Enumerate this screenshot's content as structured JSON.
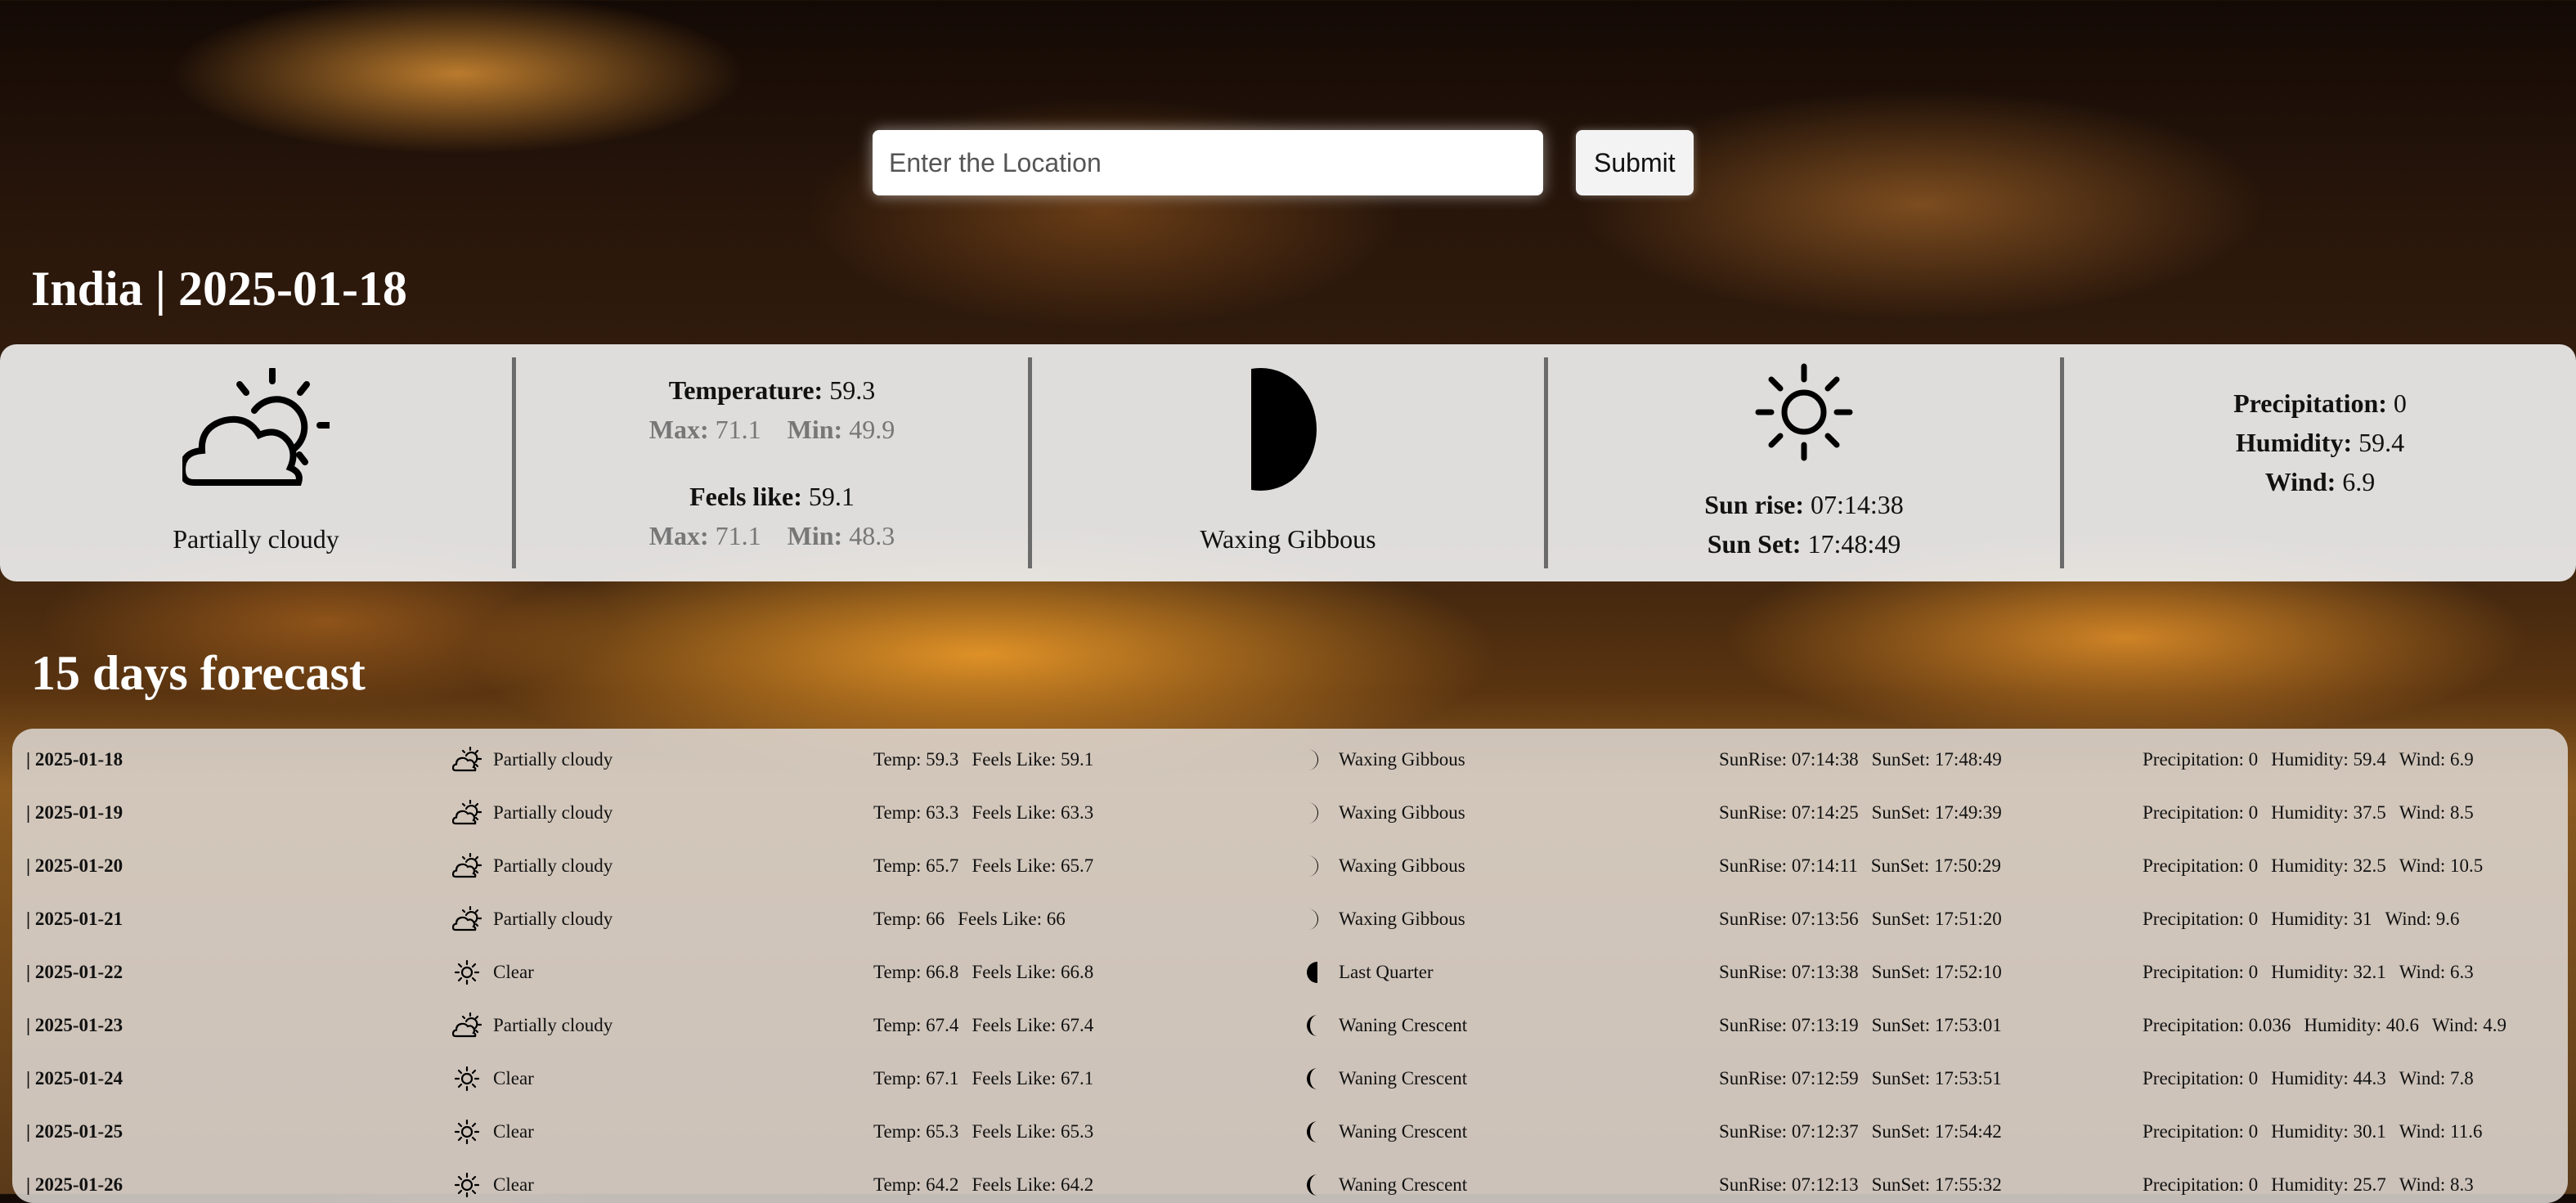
{
  "search": {
    "placeholder": "Enter the Location",
    "value": "",
    "submit_label": "Submit"
  },
  "header": {
    "title": "India | 2025-01-18"
  },
  "current": {
    "condition": "Partially cloudy",
    "condition_icon": "partly-cloudy-day-icon",
    "temperature_label": "Temperature:",
    "temperature": "59.3",
    "max_label": "Max:",
    "temp_max": "71.1",
    "min_label": "Min:",
    "temp_min": "49.9",
    "feels_label": "Feels like:",
    "feels_like": "59.1",
    "feels_max": "71.1",
    "feels_min": "48.3",
    "moon_phase": "Waxing Gibbous",
    "moon_icon": "moon-waxing-gibbous-icon",
    "sun_icon": "sun-icon",
    "sunrise_label": "Sun rise:",
    "sunrise": "07:14:38",
    "sunset_label": "Sun Set:",
    "sunset": "17:48:49",
    "precipitation_label": "Precipitation:",
    "precipitation": "0",
    "humidity_label": "Humidity:",
    "humidity": "59.4",
    "wind_label": "Wind:",
    "wind": "6.9"
  },
  "forecast": {
    "title": "15 days forecast",
    "rows": [
      {
        "date": "| 2025-01-18",
        "icon": "partly-cloudy-day-icon",
        "condition": "Partially cloudy",
        "temp": "Temp: 59.3",
        "feels": "Feels Like: 59.1",
        "moon_icon": "moon-waxing-gibbous-icon",
        "moon": "Waxing Gibbous",
        "sunrise": "SunRise: 07:14:38",
        "sunset": "SunSet: 17:48:49",
        "precip": "Precipitation: 0",
        "humidity": "Humidity: 59.4",
        "wind": "Wind: 6.9"
      },
      {
        "date": "| 2025-01-19",
        "icon": "partly-cloudy-day-icon",
        "condition": "Partially cloudy",
        "temp": "Temp: 63.3",
        "feels": "Feels Like: 63.3",
        "moon_icon": "moon-waxing-gibbous-icon",
        "moon": "Waxing Gibbous",
        "sunrise": "SunRise: 07:14:25",
        "sunset": "SunSet: 17:49:39",
        "precip": "Precipitation: 0",
        "humidity": "Humidity: 37.5",
        "wind": "Wind: 8.5"
      },
      {
        "date": "| 2025-01-20",
        "icon": "partly-cloudy-day-icon",
        "condition": "Partially cloudy",
        "temp": "Temp: 65.7",
        "feels": "Feels Like: 65.7",
        "moon_icon": "moon-waxing-gibbous-icon",
        "moon": "Waxing Gibbous",
        "sunrise": "SunRise: 07:14:11",
        "sunset": "SunSet: 17:50:29",
        "precip": "Precipitation: 0",
        "humidity": "Humidity: 32.5",
        "wind": "Wind: 10.5"
      },
      {
        "date": "| 2025-01-21",
        "icon": "partly-cloudy-day-icon",
        "condition": "Partially cloudy",
        "temp": "Temp: 66",
        "feels": "Feels Like: 66",
        "moon_icon": "moon-waxing-gibbous-icon",
        "moon": "Waxing Gibbous",
        "sunrise": "SunRise: 07:13:56",
        "sunset": "SunSet: 17:51:20",
        "precip": "Precipitation: 0",
        "humidity": "Humidity: 31",
        "wind": "Wind: 9.6"
      },
      {
        "date": "| 2025-01-22",
        "icon": "sun-icon",
        "condition": "Clear",
        "temp": "Temp: 66.8",
        "feels": "Feels Like: 66.8",
        "moon_icon": "moon-last-quarter-icon",
        "moon": "Last Quarter",
        "sunrise": "SunRise: 07:13:38",
        "sunset": "SunSet: 17:52:10",
        "precip": "Precipitation: 0",
        "humidity": "Humidity: 32.1",
        "wind": "Wind: 6.3"
      },
      {
        "date": "| 2025-01-23",
        "icon": "partly-cloudy-day-icon",
        "condition": "Partially cloudy",
        "temp": "Temp: 67.4",
        "feels": "Feels Like: 67.4",
        "moon_icon": "moon-waning-crescent-icon",
        "moon": "Waning Crescent",
        "sunrise": "SunRise: 07:13:19",
        "sunset": "SunSet: 17:53:01",
        "precip": "Precipitation: 0.036",
        "humidity": "Humidity: 40.6",
        "wind": "Wind: 4.9"
      },
      {
        "date": "| 2025-01-24",
        "icon": "sun-icon",
        "condition": "Clear",
        "temp": "Temp: 67.1",
        "feels": "Feels Like: 67.1",
        "moon_icon": "moon-waning-crescent-icon",
        "moon": "Waning Crescent",
        "sunrise": "SunRise: 07:12:59",
        "sunset": "SunSet: 17:53:51",
        "precip": "Precipitation: 0",
        "humidity": "Humidity: 44.3",
        "wind": "Wind: 7.8"
      },
      {
        "date": "| 2025-01-25",
        "icon": "sun-icon",
        "condition": "Clear",
        "temp": "Temp: 65.3",
        "feels": "Feels Like: 65.3",
        "moon_icon": "moon-waning-crescent-icon",
        "moon": "Waning Crescent",
        "sunrise": "SunRise: 07:12:37",
        "sunset": "SunSet: 17:54:42",
        "precip": "Precipitation: 0",
        "humidity": "Humidity: 30.1",
        "wind": "Wind: 11.6"
      },
      {
        "date": "| 2025-01-26",
        "icon": "sun-icon",
        "condition": "Clear",
        "temp": "Temp: 64.2",
        "feels": "Feels Like: 64.2",
        "moon_icon": "moon-waning-crescent-icon",
        "moon": "Waning Crescent",
        "sunrise": "SunRise: 07:12:13",
        "sunset": "SunSet: 17:55:32",
        "precip": "Precipitation: 0",
        "humidity": "Humidity: 25.7",
        "wind": "Wind: 8.3"
      }
    ]
  }
}
